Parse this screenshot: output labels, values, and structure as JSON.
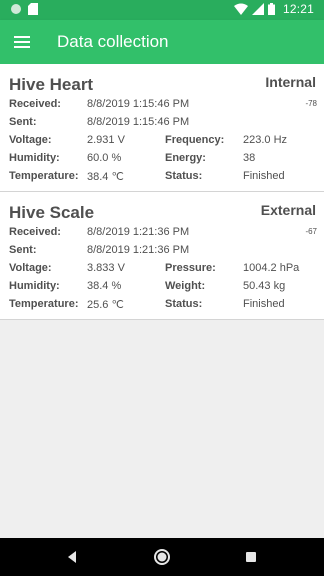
{
  "status_bar": {
    "time": "12:21",
    "icons": [
      "circle-notification-icon",
      "sd-card-icon",
      "wifi-icon",
      "signal-icon",
      "battery-icon"
    ]
  },
  "app_bar": {
    "title": "Data collection",
    "menu_icon": "hamburger-menu-icon"
  },
  "cards": [
    {
      "name": "Hive Heart",
      "type": "Internal",
      "rssi": "-78",
      "received_label": "Received:",
      "received": "8/8/2019 1:15:46 PM",
      "sent_label": "Sent:",
      "sent": "8/8/2019 1:15:46 PM",
      "rows": [
        {
          "l1": "Voltage:",
          "v1": "2.931 V",
          "l2": "Frequency:",
          "v2": "223.0 Hz"
        },
        {
          "l1": "Humidity:",
          "v1": "60.0 %",
          "l2": "Energy:",
          "v2": "38"
        },
        {
          "l1": "Temperature:",
          "v1": "38.4 ℃",
          "l2": "Status:",
          "v2": "Finished"
        }
      ]
    },
    {
      "name": "Hive Scale",
      "type": "External",
      "rssi": "-67",
      "received_label": "Received:",
      "received": "8/8/2019 1:21:36 PM",
      "sent_label": "Sent:",
      "sent": "8/8/2019 1:21:36 PM",
      "rows": [
        {
          "l1": "Voltage:",
          "v1": "3.833 V",
          "l2": "Pressure:",
          "v2": "1004.2 hPa"
        },
        {
          "l1": "Humidity:",
          "v1": "38.4 %",
          "l2": "Weight:",
          "v2": "50.43 kg"
        },
        {
          "l1": "Temperature:",
          "v1": "25.6 ℃",
          "l2": "Status:",
          "v2": "Finished"
        }
      ]
    }
  ],
  "nav_bar": {
    "buttons": [
      "back-icon",
      "home-icon",
      "recents-icon"
    ]
  },
  "colors": {
    "status_bar": "#29ad5d",
    "app_bar": "#32c06a",
    "text": "#505050",
    "background": "#efefef"
  }
}
